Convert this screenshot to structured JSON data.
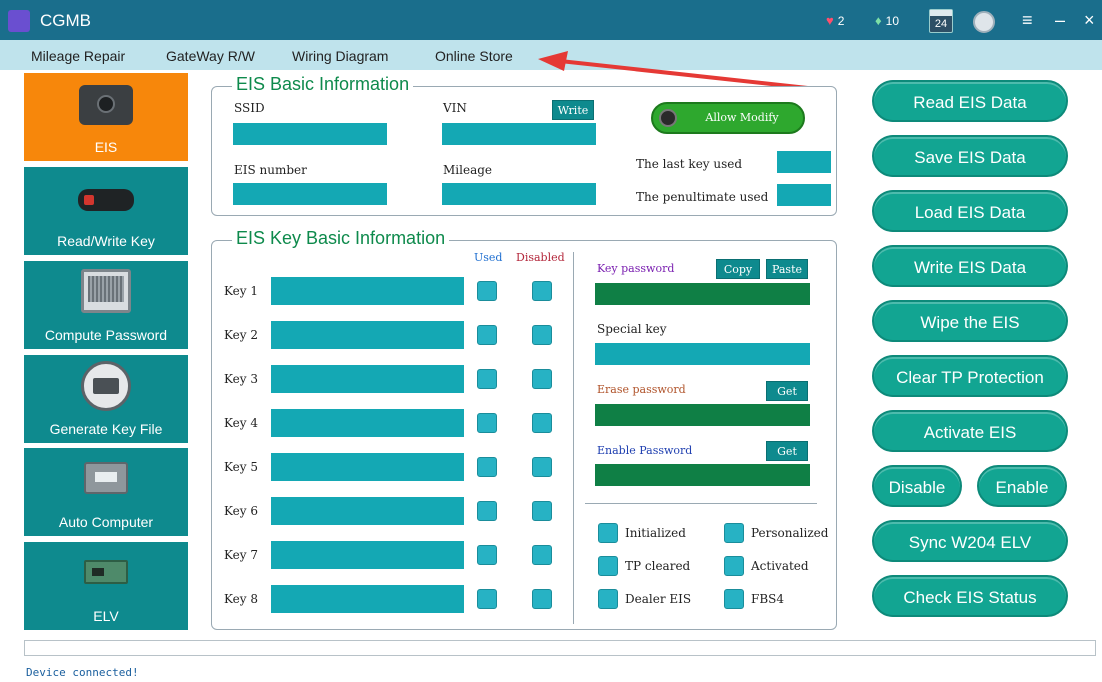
{
  "window": {
    "title": "CGMB",
    "stats": [
      {
        "icon": "red-heart-icon",
        "value": "2"
      },
      {
        "icon": "green-diamond-icon",
        "value": "10"
      },
      {
        "icon": "calendar-icon",
        "value": "24"
      }
    ]
  },
  "menu": [
    "Mileage Repair",
    "GateWay R/W",
    "Wiring Diagram",
    "Online Store"
  ],
  "nav": [
    {
      "label": "EIS",
      "icon": "eis-module-icon"
    },
    {
      "label": "Read/Write Key",
      "icon": "car-key-icon"
    },
    {
      "label": "Compute Password",
      "icon": "computer-icon"
    },
    {
      "label": "Generate Key File",
      "icon": "printer-icon"
    },
    {
      "label": "Auto Computer",
      "icon": "ecu-icon"
    },
    {
      "label": "ELV",
      "icon": "circuit-board-icon"
    }
  ],
  "eis_basic": {
    "title": "EIS Basic Information",
    "ssid_label": "SSID",
    "vin_label": "VIN",
    "write_btn": "Write",
    "allow_modify": "Allow Modify",
    "eis_number_label": "EIS number",
    "mileage_label": "Mileage",
    "last_key_label": "The last key used",
    "penultimate_label": "The penultimate used"
  },
  "eis_key": {
    "title": "EIS Key Basic Information",
    "used_header": "Used",
    "disabled_header": "Disabled",
    "keys": [
      "Key 1",
      "Key 2",
      "Key 3",
      "Key 4",
      "Key 5",
      "Key 6",
      "Key 7",
      "Key 8"
    ],
    "key_password_label": "Key password",
    "copy_btn": "Copy",
    "paste_btn": "Paste",
    "special_key_label": "Special key",
    "erase_password_label": "Erase password",
    "erase_get_btn": "Get",
    "enable_password_label": "Enable Password",
    "enable_get_btn": "Get",
    "flags": [
      "Initialized",
      "Personalized",
      "TP cleared",
      "Activated",
      "Dealer EIS",
      "FBS4"
    ]
  },
  "actions": {
    "read": "Read  EIS Data",
    "save": "Save EIS Data",
    "load": "Load EIS Data",
    "write": "Write EIS Data",
    "wipe": "Wipe the EIS",
    "clear_tp": "Clear TP Protection",
    "activate": "Activate EIS",
    "disable": "Disable",
    "enable": "Enable",
    "sync": "Sync W204 ELV",
    "check": "Check EIS Status"
  },
  "colors": {
    "titlebar": "#1a6e8c",
    "nav_active": "#f7870b",
    "nav": "#0e8a8e",
    "field": "#14a8b4",
    "password_field": "#0f7f45",
    "action_button": "#12a592",
    "annotation_arrow": "#e53935"
  },
  "status": "Device connected!"
}
